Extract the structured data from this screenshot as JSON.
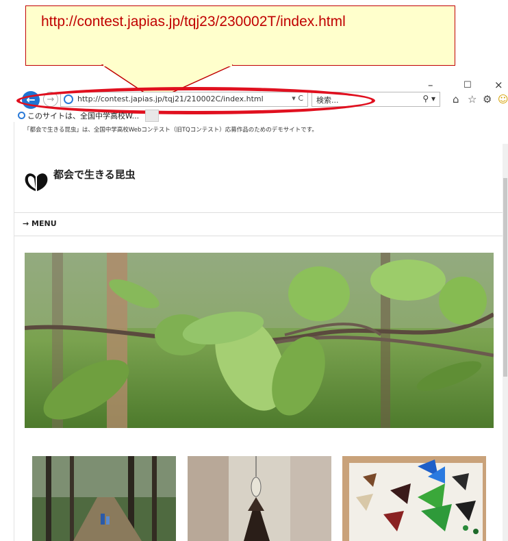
{
  "callout": {
    "text": "http://contest.japias.jp/tqj23/230002T/index.html"
  },
  "window": {
    "minimize": "–",
    "maximize": "☐",
    "close": "×"
  },
  "nav": {
    "back": "←",
    "forward": "→"
  },
  "address_bar": {
    "url": "http://contest.japias.jp/tqj21/210002C/index.html",
    "controls": "▾ C"
  },
  "search": {
    "placeholder": "検索...",
    "icon_text": "⚲ ▾"
  },
  "toolbar_icons": {
    "home": "⌂",
    "favorites": "☆",
    "settings": "⚙",
    "smiley": "☺"
  },
  "tab": {
    "title": "このサイトは、全国中学高校W..."
  },
  "page": {
    "demo_note": "「都会で生きる昆虫」は、全国中学高校Webコンテスト（旧TQコンテスト）応募作品のためのデモサイトです。",
    "site_title": "都会で生きる昆虫",
    "menu_label": "→ MENU"
  },
  "colors": {
    "callout_text": "#c00000",
    "ellipse": "#e0101f",
    "callout_fill": "#ffffcc",
    "ie_blue": "#1e73d2"
  }
}
